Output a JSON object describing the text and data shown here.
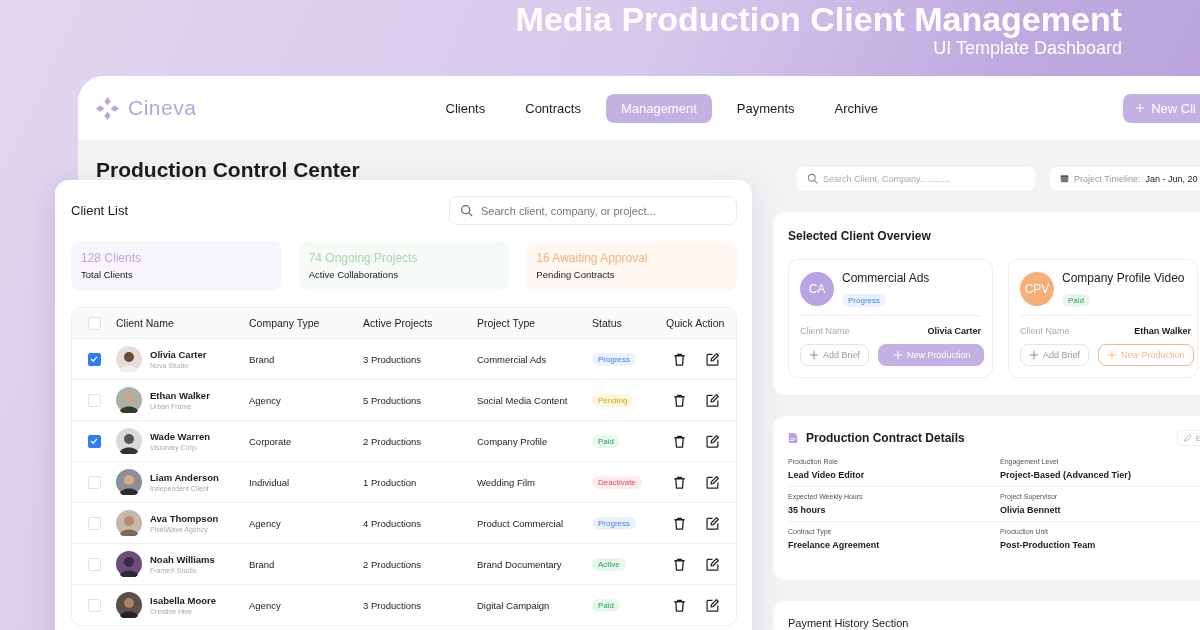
{
  "banner": {
    "title": "Media Production Client Management",
    "subtitle": "UI Template Dashboard"
  },
  "brand": {
    "name": "Cineva"
  },
  "nav": [
    {
      "label": "Clients",
      "selected": false
    },
    {
      "label": "Contracts",
      "selected": false
    },
    {
      "label": "Management",
      "selected": true
    },
    {
      "label": "Payments",
      "selected": false
    },
    {
      "label": "Archive",
      "selected": false
    }
  ],
  "new_client_button": "New Cli",
  "page_title": "Production Control Center",
  "client_list": {
    "title": "Client List",
    "search": {
      "placeholder": "Search client, company, or project..."
    },
    "stats": [
      {
        "value": "128 Clients",
        "label": "Total Clients",
        "color": "#b9a3e0"
      },
      {
        "value": "74 Ongoing Projects",
        "label": "Active Collaborations",
        "color": "#a8d4b2"
      },
      {
        "value": "16 Awaiting Approval",
        "label": "Pending Contracts",
        "color": "#f4b27a"
      }
    ],
    "all_checked": false,
    "columns": [
      "Client Name",
      "Company Type",
      "Active Projects",
      "Project Type",
      "Status",
      "Quick Action"
    ],
    "rows": [
      {
        "checked": true,
        "name": "Olivia Carter",
        "company": "Nova Studio",
        "company_type": "Brand",
        "active_projects": "3 Productions",
        "project_type": "Commercial Ads",
        "status": {
          "label": "Progress",
          "kind": "progress"
        }
      },
      {
        "checked": false,
        "name": "Ethan Walker",
        "company": "Urban Frame",
        "company_type": "Agency",
        "active_projects": "5 Productions",
        "project_type": "Social Media Content",
        "status": {
          "label": "Pending",
          "kind": "pending"
        }
      },
      {
        "checked": true,
        "name": "Wade Warren",
        "company": "Visionary Corp.",
        "company_type": "Corporate",
        "active_projects": "2 Productions",
        "project_type": "Company Profile",
        "status": {
          "label": "Paid",
          "kind": "paid"
        }
      },
      {
        "checked": false,
        "name": "Liam Anderson",
        "company": "Independent Client",
        "company_type": "Individual",
        "active_projects": "1 Production",
        "project_type": "Wedding Film",
        "status": {
          "label": "Deactivate",
          "kind": "deactivate"
        }
      },
      {
        "checked": false,
        "name": "Ava Thompson",
        "company": "PixelWave Agency",
        "company_type": "Agency",
        "active_projects": "4 Productions",
        "project_type": "Product Commercial",
        "status": {
          "label": "Progress",
          "kind": "progress"
        }
      },
      {
        "checked": false,
        "name": "Noah Williams",
        "company": "FrameX Studio",
        "company_type": "Brand",
        "active_projects": "2 Productions",
        "project_type": "Brand Documentary",
        "status": {
          "label": "Active",
          "kind": "active"
        }
      },
      {
        "checked": false,
        "name": "Isabella Moore",
        "company": "Creative Hive",
        "company_type": "Agency",
        "active_projects": "3 Productions",
        "project_type": "Digital Campaign",
        "status": {
          "label": "Paid",
          "kind": "paid"
        }
      }
    ]
  },
  "search": {
    "placeholder": "Search Client, Company............"
  },
  "timeline": {
    "label": "Project Timeline:",
    "value": "Jan - Jun, 20"
  },
  "overview": {
    "title": "Selected Client Overview",
    "cards": [
      {
        "initials": "CA",
        "color": "#b9a3e0",
        "title": "Commercial Ads",
        "status": {
          "label": "Progress",
          "kind": "progress"
        },
        "client_label": "Client Name",
        "client_name": "Olivia Carter",
        "brief_button": "Add Brief",
        "production_button": "New Production",
        "kind": "filled"
      },
      {
        "initials": "CPV",
        "color": "#f8ae78",
        "title": "Company Profile Video",
        "status": {
          "label": "Paid",
          "kind": "paid"
        },
        "client_label": "Client Name",
        "client_name": "Ethan Walker",
        "brief_button": "Add Brief",
        "production_button": "New Production",
        "kind": "outline"
      }
    ]
  },
  "contract": {
    "title": "Production Contract Details",
    "edit_button": "E",
    "fields": [
      {
        "label": "Production Role",
        "value": "Lead Video Editor"
      },
      {
        "label": "Engagement Level",
        "value": "Project-Based (Advanced Tier)"
      },
      {
        "label": "Expected Weekly Hours",
        "value": "35 hours"
      },
      {
        "label": "Project Supervisor",
        "value": "Olivia Bennett"
      },
      {
        "label": "Contract Type",
        "value": "Freelance Agreement"
      },
      {
        "label": "Production Unit",
        "value": "Post-Production Team"
      }
    ]
  },
  "payment": {
    "title": "Payment History Section"
  }
}
